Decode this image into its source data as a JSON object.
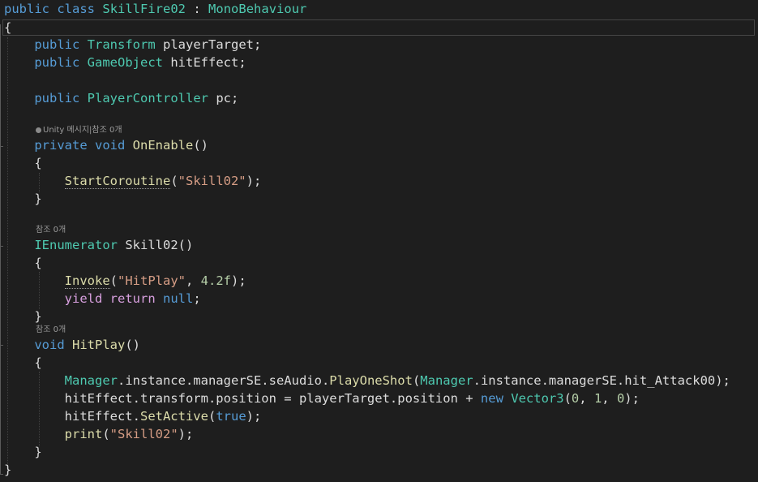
{
  "editor": {
    "class_decl": {
      "public": "public",
      "class": "class",
      "name": "SkillFire02",
      "colon": ":",
      "base": "MonoBehaviour"
    },
    "open_brace": "{",
    "close_brace": "}",
    "fields": [
      {
        "modifier": "public",
        "type": "Transform",
        "name": "playerTarget;"
      },
      {
        "modifier": "public",
        "type": "GameObject",
        "name": "hitEffect;"
      },
      {
        "modifier": "public",
        "type": "PlayerController",
        "name": "pc;"
      }
    ],
    "codelens": {
      "unity_msg": "Unity 메시지|참조 0개",
      "ref0": "참조 0개"
    },
    "onenable": {
      "private": "private",
      "void": "void",
      "name": "OnEnable",
      "parens": "()",
      "open": "{",
      "call": "StartCoroutine",
      "arg": "\"Skill02\"",
      "tail": ");",
      "close": "}"
    },
    "skill02": {
      "type": "IEnumerator",
      "name": "Skill02()",
      "open": "{",
      "invoke": "Invoke",
      "invoke_arg": "\"HitPlay\"",
      "invoke_num": "4.2f",
      "invoke_tail": ");",
      "yield": "yield",
      "return": "return",
      "null": "null",
      "semicolon": ";",
      "close": "}"
    },
    "hitplay": {
      "void": "void",
      "name": "HitPlay",
      "parens": "()",
      "open": "{",
      "l1_manager": "Manager",
      "l1_mid": ".instance.managerSE.seAudio.",
      "l1_method": "PlayOneShot",
      "l1_paren": "(",
      "l1_manager2": "Manager",
      "l1_tail": ".instance.managerSE.hit_Attack00);",
      "l2_a": "hitEffect.transform.position = playerTarget.position + ",
      "l2_new": "new",
      "l2_type": "Vector3",
      "l2_open": "(",
      "l2_n0": "0",
      "l2_n1": "1",
      "l2_n2": "0",
      "l2_close": ");",
      "l3_a": "hitEffect.",
      "l3_method": "SetActive",
      "l3_open": "(",
      "l3_true": "true",
      "l3_close": ");",
      "l4_method": "print",
      "l4_open": "(",
      "l4_str": "\"Skill02\"",
      "l4_close": ");",
      "close": "}"
    }
  }
}
